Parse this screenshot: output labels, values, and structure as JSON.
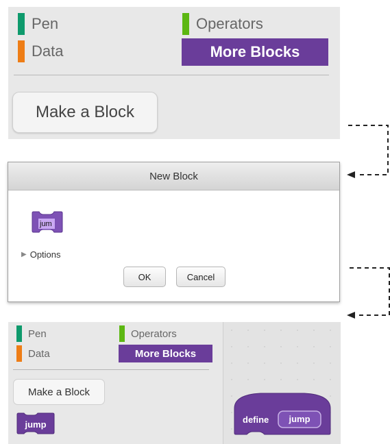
{
  "panel1": {
    "categories": [
      {
        "label": "Pen",
        "color": "#0e9a6c"
      },
      {
        "label": "Data",
        "color": "#ee7d16"
      },
      {
        "label": "Operators",
        "color": "#5cb712"
      },
      {
        "label": "More Blocks",
        "color": "#6a3d9a",
        "selected": true
      }
    ],
    "make_block_label": "Make a Block"
  },
  "dialog": {
    "title": "New Block",
    "block_input_value": "jum",
    "options_label": "Options",
    "ok_label": "OK",
    "cancel_label": "Cancel"
  },
  "panel3": {
    "categories": [
      {
        "label": "Pen",
        "color": "#0e9a6c"
      },
      {
        "label": "Data",
        "color": "#ee7d16"
      },
      {
        "label": "Operators",
        "color": "#5cb712"
      },
      {
        "label": "More Blocks",
        "color": "#6a3d9a",
        "selected": true
      }
    ],
    "make_block_label": "Make a Block",
    "jump_block_label": "jump",
    "define_label": "define",
    "define_param": "jump"
  },
  "colors": {
    "block_purple": "#6a3d9a",
    "block_light": "#8d62c2",
    "palette_bg": "#e8e8e8"
  }
}
